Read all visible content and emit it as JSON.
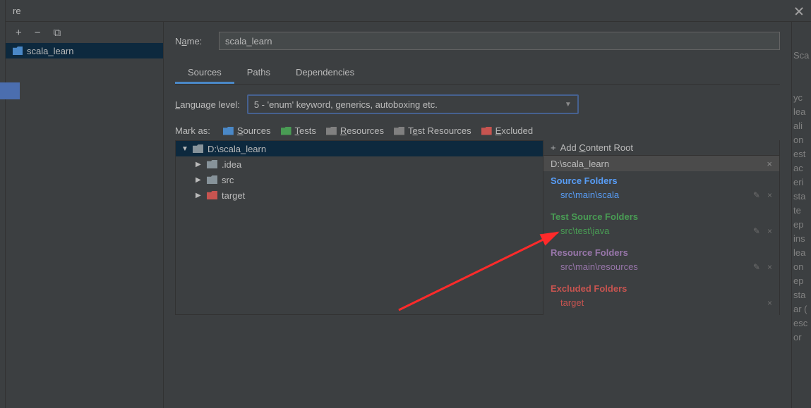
{
  "titlebar": {
    "title": "re"
  },
  "toolbar": {
    "add": "+",
    "remove": "−",
    "copy": "⧉"
  },
  "left": {
    "module_name": "scala_learn"
  },
  "name_field": {
    "label": "Name:",
    "value": "scala_learn"
  },
  "tabs": {
    "sources": "Sources",
    "paths": "Paths",
    "dependencies": "Dependencies"
  },
  "lang": {
    "label": "Language level:",
    "value": "5 - 'enum' keyword, generics, autoboxing etc."
  },
  "mark": {
    "label": "Mark as:",
    "sources": "Sources",
    "tests": "Tests",
    "resources": "Resources",
    "test_resources": "Test Resources",
    "excluded": "Excluded"
  },
  "tree": {
    "root": "D:\\scala_learn",
    "children": [
      ".idea",
      "src",
      "target"
    ]
  },
  "right": {
    "add_content": "Add Content Root",
    "path": "D:\\scala_learn",
    "sections": [
      {
        "title": "Source Folders",
        "color": "blue",
        "items": [
          "src\\main\\scala"
        ],
        "editable": true
      },
      {
        "title": "Test Source Folders",
        "color": "green",
        "items": [
          "src\\test\\java"
        ],
        "editable": true
      },
      {
        "title": "Resource Folders",
        "color": "purple",
        "items": [
          "src\\main\\resources"
        ],
        "editable": true
      },
      {
        "title": "Excluded Folders",
        "color": "red",
        "items": [
          "target"
        ],
        "editable": false
      }
    ]
  },
  "rightspine": [
    "Sca",
    "",
    "",
    "yc",
    "lea",
    "ali",
    "on",
    "est",
    "ac",
    "eri",
    "sta",
    "te",
    "ep",
    "ins",
    "lea",
    "on",
    "ep",
    "sta",
    "ar (",
    "esc",
    "or"
  ]
}
